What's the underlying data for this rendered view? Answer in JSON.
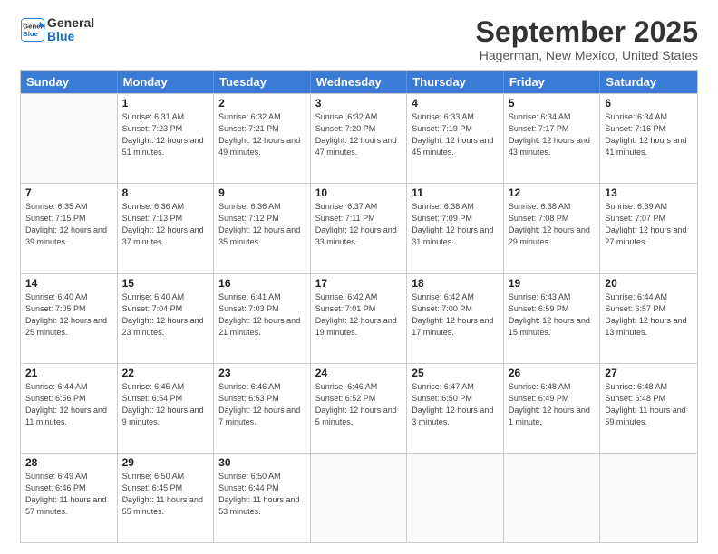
{
  "header": {
    "logo_line1": "General",
    "logo_line2": "Blue",
    "month": "September 2025",
    "location": "Hagerman, New Mexico, United States"
  },
  "weekdays": [
    "Sunday",
    "Monday",
    "Tuesday",
    "Wednesday",
    "Thursday",
    "Friday",
    "Saturday"
  ],
  "weeks": [
    [
      {
        "day": "",
        "empty": true
      },
      {
        "day": "1",
        "sunrise": "6:31 AM",
        "sunset": "7:23 PM",
        "daylight": "12 hours and 51 minutes."
      },
      {
        "day": "2",
        "sunrise": "6:32 AM",
        "sunset": "7:21 PM",
        "daylight": "12 hours and 49 minutes."
      },
      {
        "day": "3",
        "sunrise": "6:32 AM",
        "sunset": "7:20 PM",
        "daylight": "12 hours and 47 minutes."
      },
      {
        "day": "4",
        "sunrise": "6:33 AM",
        "sunset": "7:19 PM",
        "daylight": "12 hours and 45 minutes."
      },
      {
        "day": "5",
        "sunrise": "6:34 AM",
        "sunset": "7:17 PM",
        "daylight": "12 hours and 43 minutes."
      },
      {
        "day": "6",
        "sunrise": "6:34 AM",
        "sunset": "7:16 PM",
        "daylight": "12 hours and 41 minutes."
      }
    ],
    [
      {
        "day": "7",
        "sunrise": "6:35 AM",
        "sunset": "7:15 PM",
        "daylight": "12 hours and 39 minutes."
      },
      {
        "day": "8",
        "sunrise": "6:36 AM",
        "sunset": "7:13 PM",
        "daylight": "12 hours and 37 minutes."
      },
      {
        "day": "9",
        "sunrise": "6:36 AM",
        "sunset": "7:12 PM",
        "daylight": "12 hours and 35 minutes."
      },
      {
        "day": "10",
        "sunrise": "6:37 AM",
        "sunset": "7:11 PM",
        "daylight": "12 hours and 33 minutes."
      },
      {
        "day": "11",
        "sunrise": "6:38 AM",
        "sunset": "7:09 PM",
        "daylight": "12 hours and 31 minutes."
      },
      {
        "day": "12",
        "sunrise": "6:38 AM",
        "sunset": "7:08 PM",
        "daylight": "12 hours and 29 minutes."
      },
      {
        "day": "13",
        "sunrise": "6:39 AM",
        "sunset": "7:07 PM",
        "daylight": "12 hours and 27 minutes."
      }
    ],
    [
      {
        "day": "14",
        "sunrise": "6:40 AM",
        "sunset": "7:05 PM",
        "daylight": "12 hours and 25 minutes."
      },
      {
        "day": "15",
        "sunrise": "6:40 AM",
        "sunset": "7:04 PM",
        "daylight": "12 hours and 23 minutes."
      },
      {
        "day": "16",
        "sunrise": "6:41 AM",
        "sunset": "7:03 PM",
        "daylight": "12 hours and 21 minutes."
      },
      {
        "day": "17",
        "sunrise": "6:42 AM",
        "sunset": "7:01 PM",
        "daylight": "12 hours and 19 minutes."
      },
      {
        "day": "18",
        "sunrise": "6:42 AM",
        "sunset": "7:00 PM",
        "daylight": "12 hours and 17 minutes."
      },
      {
        "day": "19",
        "sunrise": "6:43 AM",
        "sunset": "6:59 PM",
        "daylight": "12 hours and 15 minutes."
      },
      {
        "day": "20",
        "sunrise": "6:44 AM",
        "sunset": "6:57 PM",
        "daylight": "12 hours and 13 minutes."
      }
    ],
    [
      {
        "day": "21",
        "sunrise": "6:44 AM",
        "sunset": "6:56 PM",
        "daylight": "12 hours and 11 minutes."
      },
      {
        "day": "22",
        "sunrise": "6:45 AM",
        "sunset": "6:54 PM",
        "daylight": "12 hours and 9 minutes."
      },
      {
        "day": "23",
        "sunrise": "6:46 AM",
        "sunset": "6:53 PM",
        "daylight": "12 hours and 7 minutes."
      },
      {
        "day": "24",
        "sunrise": "6:46 AM",
        "sunset": "6:52 PM",
        "daylight": "12 hours and 5 minutes."
      },
      {
        "day": "25",
        "sunrise": "6:47 AM",
        "sunset": "6:50 PM",
        "daylight": "12 hours and 3 minutes."
      },
      {
        "day": "26",
        "sunrise": "6:48 AM",
        "sunset": "6:49 PM",
        "daylight": "12 hours and 1 minute."
      },
      {
        "day": "27",
        "sunrise": "6:48 AM",
        "sunset": "6:48 PM",
        "daylight": "11 hours and 59 minutes."
      }
    ],
    [
      {
        "day": "28",
        "sunrise": "6:49 AM",
        "sunset": "6:46 PM",
        "daylight": "11 hours and 57 minutes."
      },
      {
        "day": "29",
        "sunrise": "6:50 AM",
        "sunset": "6:45 PM",
        "daylight": "11 hours and 55 minutes."
      },
      {
        "day": "30",
        "sunrise": "6:50 AM",
        "sunset": "6:44 PM",
        "daylight": "11 hours and 53 minutes."
      },
      {
        "day": "",
        "empty": true
      },
      {
        "day": "",
        "empty": true
      },
      {
        "day": "",
        "empty": true
      },
      {
        "day": "",
        "empty": true
      }
    ]
  ]
}
